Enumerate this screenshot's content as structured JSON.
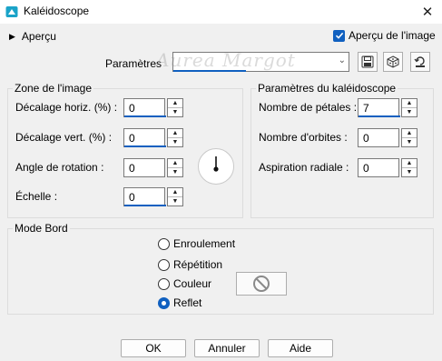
{
  "window": {
    "title": "Kaléidoscope",
    "close_glyph": "✕"
  },
  "preview": {
    "label": "Aperçu",
    "checkbox_label": "Aperçu de l'image",
    "checked": true
  },
  "params": {
    "label": "Paramètres",
    "value": "",
    "watermark": "Aurea Margot"
  },
  "zone": {
    "title": "Zone de l'image",
    "fields": [
      {
        "label": "Décalage horiz. (%) :",
        "value": "0"
      },
      {
        "label": "Décalage vert. (%) :",
        "value": "0"
      },
      {
        "label": "Angle de rotation :",
        "value": "0"
      },
      {
        "label": "Échelle :",
        "value": "0"
      }
    ]
  },
  "kaleido": {
    "title": "Paramètres du kaléidoscope",
    "fields": [
      {
        "label": "Nombre de pétales :",
        "value": "7"
      },
      {
        "label": "Nombre d'orbites :",
        "value": "0"
      },
      {
        "label": "Aspiration radiale :",
        "value": "0"
      }
    ]
  },
  "mode": {
    "title": "Mode Bord",
    "options": [
      "Enroulement",
      "Répétition",
      "Couleur",
      "Reflet"
    ],
    "selected": "Reflet"
  },
  "buttons": {
    "ok": "OK",
    "cancel": "Annuler",
    "help": "Aide"
  },
  "colors": {
    "accent": "#1060c0",
    "background": "#f0f0f0"
  }
}
